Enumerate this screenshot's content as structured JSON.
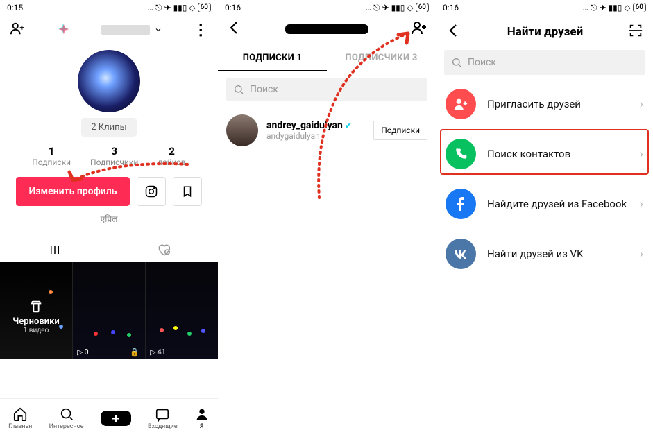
{
  "status": {
    "time1": "0:15",
    "time2": "0:16",
    "time3": "0:16",
    "battery": "60"
  },
  "screen1": {
    "clips_btn": "2 Клипы",
    "stats": [
      {
        "num": "1",
        "label": "Подписки"
      },
      {
        "num": "3",
        "label": "Подписчики"
      },
      {
        "num": "2",
        "label": "лайков"
      }
    ],
    "edit_btn": "Изменить профиль",
    "caption": "एप्रिल",
    "drafts_title": "Черновики",
    "drafts_sub": "1 видео",
    "cell2_plays": "0",
    "cell3_plays": "41",
    "nav": [
      "Главная",
      "Интересное",
      "",
      "Входящие",
      "Я"
    ]
  },
  "screen2": {
    "tab_following": "ПОДПИСКИ 1",
    "tab_followers": "ПОДПИСЧИКИ 3",
    "search_ph": "Поиск",
    "user_name": "andrey_gaidulyan",
    "user_handle": "andygaidulyan",
    "sub_btn": "Подписки"
  },
  "screen3": {
    "title": "Найти друзей",
    "search_ph": "Поиск",
    "opts": [
      "Пригласить друзей",
      "Поиск контактов",
      "Найдите друзей из Facebook",
      "Найти друзей из VK"
    ]
  }
}
